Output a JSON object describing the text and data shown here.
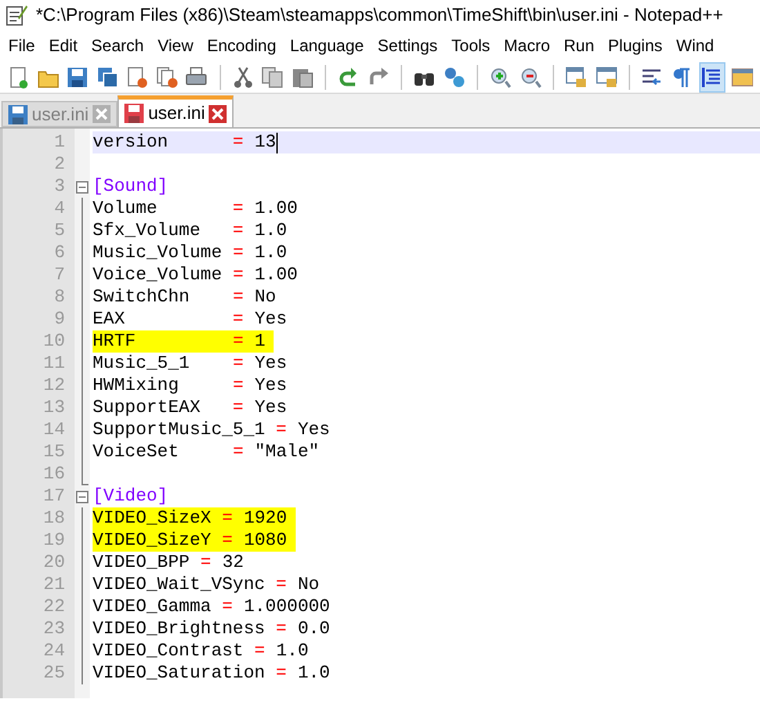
{
  "window": {
    "title": "*C:\\Program Files (x86)\\Steam\\steamapps\\common\\TimeShift\\bin\\user.ini - Notepad++"
  },
  "menu": [
    "File",
    "Edit",
    "Search",
    "View",
    "Encoding",
    "Language",
    "Settings",
    "Tools",
    "Macro",
    "Run",
    "Plugins",
    "Wind"
  ],
  "toolbar": [
    {
      "kind": "new",
      "pressed": false
    },
    {
      "kind": "open",
      "pressed": false
    },
    {
      "kind": "save",
      "pressed": false
    },
    {
      "kind": "saveall",
      "pressed": false
    },
    {
      "kind": "close",
      "pressed": false
    },
    {
      "kind": "closeall",
      "pressed": false
    },
    {
      "kind": "print",
      "pressed": false
    },
    {
      "kind": "sep"
    },
    {
      "kind": "cut",
      "pressed": false
    },
    {
      "kind": "copy",
      "pressed": false
    },
    {
      "kind": "paste",
      "pressed": false
    },
    {
      "kind": "sep"
    },
    {
      "kind": "undo",
      "pressed": false
    },
    {
      "kind": "redo",
      "pressed": false
    },
    {
      "kind": "sep"
    },
    {
      "kind": "find",
      "pressed": false
    },
    {
      "kind": "replace",
      "pressed": false
    },
    {
      "kind": "sep"
    },
    {
      "kind": "zoomin",
      "pressed": false
    },
    {
      "kind": "zoomout",
      "pressed": false
    },
    {
      "kind": "sep"
    },
    {
      "kind": "syncv",
      "pressed": false
    },
    {
      "kind": "synch",
      "pressed": false
    },
    {
      "kind": "sep"
    },
    {
      "kind": "wrap",
      "pressed": false
    },
    {
      "kind": "pilcrow",
      "pressed": false
    },
    {
      "kind": "indent",
      "pressed": true
    },
    {
      "kind": "folder",
      "pressed": false
    }
  ],
  "tabs": [
    {
      "label": "user.ini",
      "selected": false,
      "modified": false
    },
    {
      "label": "user.ini",
      "selected": true,
      "modified": true
    }
  ],
  "lines": [
    {
      "number": "1",
      "kind": "pair",
      "key": "version      ",
      "operator": "=",
      "value": "13",
      "current": true,
      "highlighted": false
    },
    {
      "number": "2",
      "kind": "blank"
    },
    {
      "number": "3",
      "kind": "section",
      "text": "[Sound]"
    },
    {
      "number": "4",
      "kind": "pair",
      "key": "Volume       ",
      "operator": "=",
      "value": "1.00",
      "current": false,
      "highlighted": false
    },
    {
      "number": "5",
      "kind": "pair",
      "key": "Sfx_Volume   ",
      "operator": "=",
      "value": "1.0",
      "current": false,
      "highlighted": false
    },
    {
      "number": "6",
      "kind": "pair",
      "key": "Music_Volume ",
      "operator": "=",
      "value": "1.0",
      "current": false,
      "highlighted": false
    },
    {
      "number": "7",
      "kind": "pair",
      "key": "Voice_Volume ",
      "operator": "=",
      "value": "1.00",
      "current": false,
      "highlighted": false
    },
    {
      "number": "8",
      "kind": "pair",
      "key": "SwitchChn    ",
      "operator": "=",
      "value": "No",
      "current": false,
      "highlighted": false
    },
    {
      "number": "9",
      "kind": "pair",
      "key": "EAX          ",
      "operator": "=",
      "value": "Yes",
      "current": false,
      "highlighted": false
    },
    {
      "number": "10",
      "kind": "pair",
      "key": "HRTF         ",
      "operator": "=",
      "value": "1",
      "current": false,
      "highlighted": true
    },
    {
      "number": "11",
      "kind": "pair",
      "key": "Music_5_1    ",
      "operator": "=",
      "value": "Yes",
      "current": false,
      "highlighted": false
    },
    {
      "number": "12",
      "kind": "pair",
      "key": "HWMixing     ",
      "operator": "=",
      "value": "Yes",
      "current": false,
      "highlighted": false
    },
    {
      "number": "13",
      "kind": "pair",
      "key": "SupportEAX   ",
      "operator": "=",
      "value": "Yes",
      "current": false,
      "highlighted": false
    },
    {
      "number": "14",
      "kind": "pair",
      "key": "SupportMusic_5_1 ",
      "operator": "=",
      "value": "Yes",
      "current": false,
      "highlighted": false
    },
    {
      "number": "15",
      "kind": "pair",
      "key": "VoiceSet     ",
      "operator": "=",
      "value": "\"Male\"",
      "current": false,
      "highlighted": false
    },
    {
      "number": "16",
      "kind": "blank"
    },
    {
      "number": "17",
      "kind": "section",
      "text": "[Video]"
    },
    {
      "number": "18",
      "kind": "pair",
      "key": "VIDEO_SizeX ",
      "operator": "=",
      "value": "1920",
      "current": false,
      "highlighted": true
    },
    {
      "number": "19",
      "kind": "pair",
      "key": "VIDEO_SizeY ",
      "operator": "=",
      "value": "1080",
      "current": false,
      "highlighted": true
    },
    {
      "number": "20",
      "kind": "pair",
      "key": "VIDEO_BPP ",
      "operator": "=",
      "value": "32",
      "current": false,
      "highlighted": false
    },
    {
      "number": "21",
      "kind": "pair",
      "key": "VIDEO_Wait_VSync ",
      "operator": "=",
      "value": "No",
      "current": false,
      "highlighted": false
    },
    {
      "number": "22",
      "kind": "pair",
      "key": "VIDEO_Gamma ",
      "operator": "=",
      "value": "1.000000",
      "current": false,
      "highlighted": false
    },
    {
      "number": "23",
      "kind": "pair",
      "key": "VIDEO_Brightness ",
      "operator": "=",
      "value": "0.0",
      "current": false,
      "highlighted": false
    },
    {
      "number": "24",
      "kind": "pair",
      "key": "VIDEO_Contrast ",
      "operator": "=",
      "value": "1.0",
      "current": false,
      "highlighted": false
    },
    {
      "number": "25",
      "kind": "pair",
      "key": "VIDEO_Saturation ",
      "operator": "=",
      "value": "1.0",
      "current": false,
      "highlighted": false
    }
  ]
}
